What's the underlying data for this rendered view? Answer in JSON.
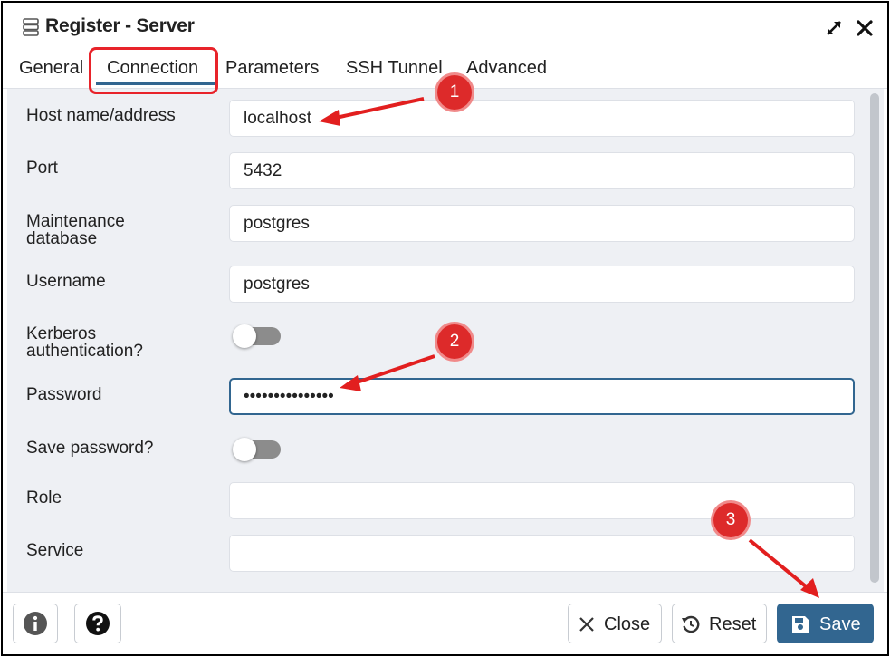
{
  "window": {
    "title": "Register - Server"
  },
  "tabs": [
    {
      "label": "General"
    },
    {
      "label": "Connection"
    },
    {
      "label": "Parameters"
    },
    {
      "label": "SSH Tunnel"
    },
    {
      "label": "Advanced"
    }
  ],
  "active_tab": "Connection",
  "form": {
    "host": {
      "label": "Host name/address",
      "value": "localhost"
    },
    "port": {
      "label": "Port",
      "value": "5432"
    },
    "maintenance_db": {
      "label_line1": "Maintenance",
      "label_line2": "database",
      "value": "postgres"
    },
    "username": {
      "label": "Username",
      "value": "postgres"
    },
    "kerberos": {
      "label_line1": "Kerberos",
      "label_line2": "authentication?",
      "enabled": false
    },
    "password": {
      "label": "Password",
      "value": "•••••••••••••••"
    },
    "save_password": {
      "label": "Save password?",
      "enabled": false
    },
    "role": {
      "label": "Role",
      "value": ""
    },
    "service": {
      "label": "Service",
      "value": ""
    }
  },
  "footer": {
    "close_label": "Close",
    "reset_label": "Reset",
    "save_label": "Save"
  },
  "annotations": {
    "badge1": "1",
    "badge2": "2",
    "badge3": "3",
    "color": "#dd2a2a"
  },
  "colors": {
    "accent": "#326690",
    "highlight_box": "#e8232a",
    "content_bg": "#eef0f4"
  }
}
